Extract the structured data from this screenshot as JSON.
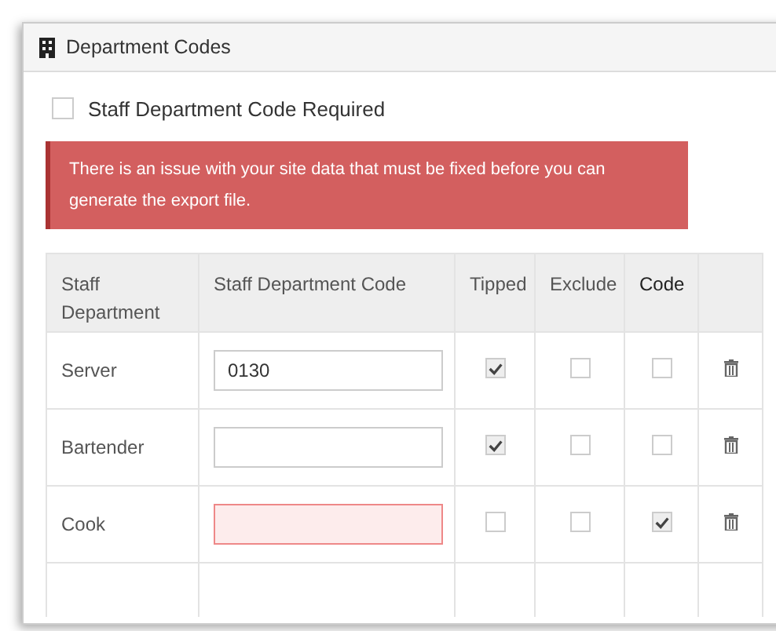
{
  "panel": {
    "title": "Department Codes"
  },
  "required_option": {
    "label": "Staff Department Code Required",
    "checked": false
  },
  "alert": {
    "message": "There is an issue with your site data that must be fixed before you can generate the export file."
  },
  "table": {
    "columns": [
      "Staff Department",
      "Staff Department Code",
      "Tipped",
      "Exclude",
      "Code"
    ],
    "rows": [
      {
        "department": "Server",
        "code": "0130",
        "invalid": false,
        "tipped": true,
        "exclude": false,
        "code_flag": false
      },
      {
        "department": "Bartender",
        "code": "",
        "invalid": false,
        "tipped": true,
        "exclude": false,
        "code_flag": false
      },
      {
        "department": "Cook",
        "code": "",
        "invalid": true,
        "tipped": false,
        "exclude": false,
        "code_flag": true
      }
    ]
  }
}
